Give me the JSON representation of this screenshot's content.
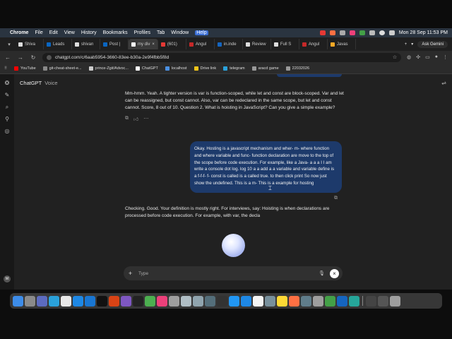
{
  "menubar": {
    "app_name": "Chrome",
    "items": [
      "File",
      "Edit",
      "View",
      "History",
      "Bookmarks",
      "Profiles",
      "Tab",
      "Window",
      "Help"
    ],
    "datetime": "Mon 28 Sep  11:53 PM"
  },
  "tabs": [
    {
      "label": "Shiva"
    },
    {
      "label": "Leads"
    },
    {
      "label": "shivan"
    },
    {
      "label": "Post |"
    },
    {
      "label": "my div"
    },
    {
      "label": "(601)"
    },
    {
      "label": "Angul"
    },
    {
      "label": "in.inde"
    },
    {
      "label": "Review"
    },
    {
      "label": "Full S"
    },
    {
      "label": "Angul"
    },
    {
      "label": "Javas"
    }
  ],
  "toolbar": {
    "url": "chatgpt.com/c/6aab5954-3660-83ee-b30a-2e9f4fbb5f8d",
    "ask_gemini": "Ask Gemini"
  },
  "bookmarks": [
    {
      "label": "YouTube",
      "color": "#ff0000"
    },
    {
      "label": "git-cheat-sheet-e...",
      "color": "#888888"
    },
    {
      "label": "prince-Zgit/Advoc...",
      "color": "#cccccc"
    },
    {
      "label": "ChatGPT",
      "color": "#ffffff"
    },
    {
      "label": "localhost",
      "color": "#4a90e2"
    },
    {
      "label": "Drive link",
      "color": "#f0c419"
    },
    {
      "label": "telegram",
      "color": "#2aa1da"
    },
    {
      "label": "aracd game",
      "color": "#999999"
    },
    {
      "label": "22032026",
      "color": "#999999"
    }
  ],
  "app": {
    "title": "ChatGPT",
    "subtitle": "Voice",
    "assistant_message_1": "Mm-hmm. Yeah. A tighter version is var is function-scoped, while let and const are block-scoped. Var and let can be reassigned, but const cannot. Also, var can be redeclared in the same scope, but let and const cannot. Score, 8 out of 10. Question 2. What is hoisting in JavaScript? Can you give a simple example?",
    "user_message": "Okay. Hosting is a javascript mechanism and wher- m- where function and where variable and func- function declaration are move to the top of the scope before code execution. For example, like a Java- a a a I I am write a console dot log. log 10 a a add a a variable and variable define is a f-f-f- f- const is called is a called true. to then click print So now just show the undefined. This is a m- This is a example for hosting",
    "assistant_message_2": "Checking. Good. Your definition is mostly right. For interviews, say: Hoisting is when declarations are processed before code execution. For example, with var, the decla",
    "composer_placeholder": "Type",
    "avatar_initial": "M"
  },
  "dock": {
    "apps": [
      {
        "name": "finder-icon",
        "color": "#3d8ce8"
      },
      {
        "name": "launchpad-icon",
        "color": "#8a8a8a"
      },
      {
        "name": "grid-icon",
        "color": "#5c6bc0"
      },
      {
        "name": "telegram-icon",
        "color": "#2aa1da"
      },
      {
        "name": "chrome-icon",
        "color": "#e8e8e8"
      },
      {
        "name": "safari-icon",
        "color": "#1e88e5"
      },
      {
        "name": "vscode-icon",
        "color": "#1976d2"
      },
      {
        "name": "netflix-icon",
        "color": "#111111"
      },
      {
        "name": "photo-icon",
        "color": "#d84315"
      },
      {
        "name": "app-icon",
        "color": "#7e57c2"
      },
      {
        "name": "cursor-app-icon",
        "color": "#222222"
      },
      {
        "name": "android-studio-icon",
        "color": "#4caf50"
      },
      {
        "name": "music-icon",
        "color": "#ec407a"
      },
      {
        "name": "app-icon",
        "color": "#9e9e9e"
      },
      {
        "name": "app-icon",
        "color": "#b0bec5"
      },
      {
        "name": "app-icon",
        "color": "#90a4ae"
      },
      {
        "name": "app-icon",
        "color": "#546e7a"
      },
      {
        "name": "terminal-icon",
        "color": "#333333"
      },
      {
        "name": "app-icon",
        "color": "#2196f3"
      },
      {
        "name": "app-store-icon",
        "color": "#1e88e5"
      },
      {
        "name": "calendar-icon",
        "color": "#f5f5f5"
      },
      {
        "name": "app-icon",
        "color": "#78909c"
      },
      {
        "name": "notes-icon",
        "color": "#fdd835"
      },
      {
        "name": "app-icon",
        "color": "#ff7043"
      },
      {
        "name": "app-icon",
        "color": "#607d8b"
      },
      {
        "name": "app-icon",
        "color": "#9e9e9e"
      },
      {
        "name": "whatsapp-icon",
        "color": "#43a047"
      },
      {
        "name": "app-icon",
        "color": "#1565c0"
      },
      {
        "name": "app-icon",
        "color": "#26a69a"
      }
    ],
    "right_apps": [
      {
        "name": "app-icon",
        "color": "#444444"
      },
      {
        "name": "app-icon",
        "color": "#555555"
      },
      {
        "name": "trash-icon",
        "color": "#9e9e9e"
      }
    ]
  }
}
